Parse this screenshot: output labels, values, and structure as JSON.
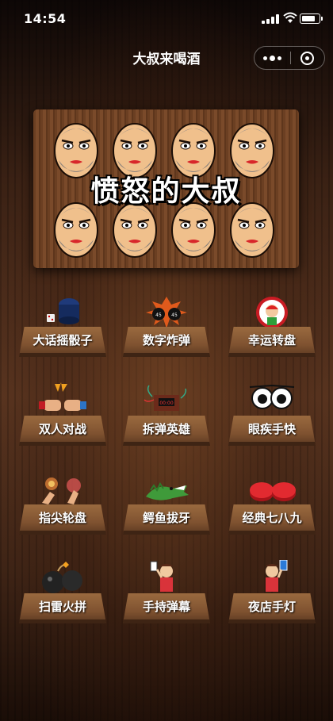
{
  "status_bar": {
    "time": "14:54"
  },
  "nav": {
    "title": "大叔来喝酒"
  },
  "banner": {
    "title": "愤怒的大叔"
  },
  "games": [
    {
      "label": "大话摇骰子",
      "icon": "dice-cup-icon"
    },
    {
      "label": "数字炸弹",
      "icon": "bomb-icon"
    },
    {
      "label": "幸运转盘",
      "icon": "lucky-wheel-icon"
    },
    {
      "label": "双人对战",
      "icon": "fist-bump-icon"
    },
    {
      "label": "拆弹英雄",
      "icon": "dynamite-icon"
    },
    {
      "label": "眼疾手快",
      "icon": "eyes-icon"
    },
    {
      "label": "指尖轮盘",
      "icon": "fingertip-icon"
    },
    {
      "label": "鳄鱼拔牙",
      "icon": "crocodile-icon"
    },
    {
      "label": "经典七八九",
      "icon": "red-button-icon"
    },
    {
      "label": "扫雷火拼",
      "icon": "mine-bomb-icon"
    },
    {
      "label": "手持弹幕",
      "icon": "handheld-barrage-icon"
    },
    {
      "label": "夜店手灯",
      "icon": "nightclub-light-icon"
    }
  ]
}
